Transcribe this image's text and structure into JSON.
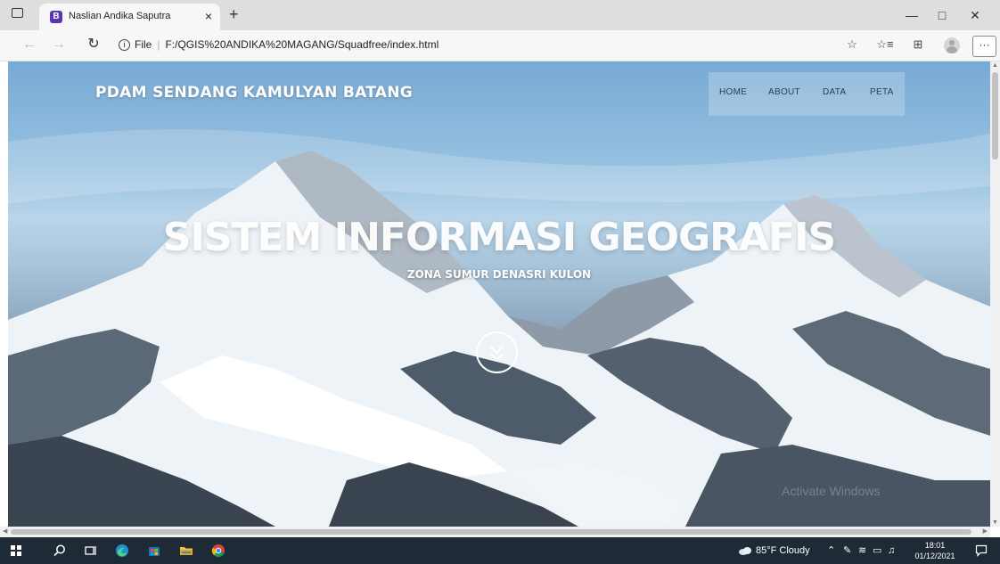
{
  "browser": {
    "tab_title": "Naslian Andika Saputra",
    "favicon_letter": "B",
    "tab_close": "×",
    "new_tab": "+",
    "address_prefix": "File",
    "address_separator": "|",
    "url": "F:/QGIS%20ANDIKA%20MAGANG/Squadfree/index.html",
    "menu_dots": "···",
    "icons": [
      "tab-actions-icon",
      "back-icon",
      "forward-icon",
      "refresh-icon",
      "info-icon",
      "read-aloud-icon",
      "favorites-icon",
      "collections-icon",
      "profile-icon",
      "minimize-icon",
      "restore-icon",
      "close-icon"
    ]
  },
  "page": {
    "brand": "PDAM SENDANG KAMULYAN BATANG",
    "nav": [
      {
        "label": "HOME",
        "active": true
      },
      {
        "label": "ABOUT"
      },
      {
        "label": "DATA"
      },
      {
        "label": "PETA"
      }
    ],
    "hero_title": "SISTEM INFORMASI GEOGRAFIS",
    "hero_subtitle": "ZONA SUMUR DENASRI KULON",
    "watermark": "Activate Windows"
  },
  "taskbar": {
    "weather": "85°F Cloudy",
    "time": "18:01",
    "date": "01/12/2021",
    "icons": [
      "windows-start-icon",
      "search-icon",
      "task-view-icon",
      "edge-icon",
      "store-icon",
      "file-explorer-icon",
      "chrome-icon",
      "weather-icon",
      "chevron-up-icon",
      "pen-icon",
      "wifi-icon",
      "battery-icon",
      "volume-icon",
      "notification-icon"
    ]
  },
  "colors": {
    "tab_strip": "#dedede",
    "toolbar": "#f7f7f7",
    "taskbar": "#1f2a37",
    "favicon": "#5b35b5",
    "nav_text": "#2a3c52"
  }
}
